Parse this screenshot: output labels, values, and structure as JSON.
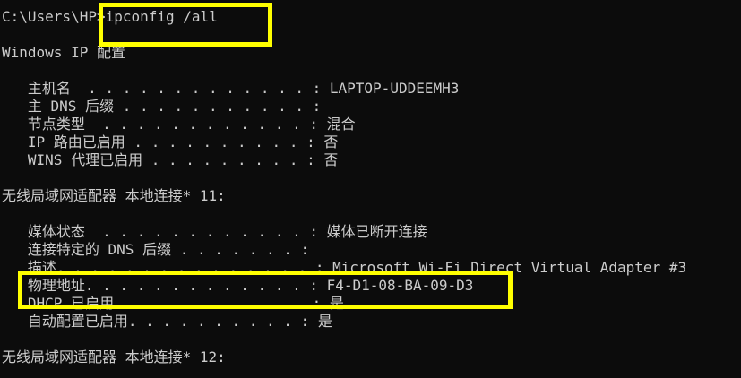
{
  "terminal": {
    "background": "#0c0c0c",
    "text_color": "#cccccc",
    "highlight_color": "#ffff00",
    "lines": {
      "prompt": "C:\\Users\\HP>ipconfig /all",
      "windows_ip_config": "Windows IP 配置",
      "hostname": "   主机名  . . . . . . . . . . . . . : LAPTOP-UDDEEMH3",
      "primary_dns_suffix": "   主 DNS 后缀 . . . . . . . . . . . :",
      "node_type": "   节点类型  . . . . . . . . . . . . : 混合",
      "ip_routing": "   IP 路由已启用 . . . . . . . . . . : 否",
      "wins_proxy": "   WINS 代理已启用 . . . . . . . . . : 否",
      "adapter_11_header": "无线局域网适配器 本地连接* 11:",
      "media_state": "   媒体状态  . . . . . . . . . . . . : 媒体已断开连接",
      "connection_dns_suffix": "   连接特定的 DNS 后缀 . . . . . . . :",
      "description": "   描述. . . . . . . . . . . . . . . : Microsoft Wi-Fi Direct Virtual Adapter #3",
      "physical_address": "   物理地址. . . . . . . . . . . . . : F4-D1-08-BA-09-D3",
      "dhcp_enabled": "   DHCP 已启用 . . . . . . . . . . . : 是",
      "autoconfig_enabled": "   自动配置已启用. . . . . . . . . . : 是",
      "adapter_12_header": "无线局域网适配器 本地连接* 12:"
    }
  }
}
